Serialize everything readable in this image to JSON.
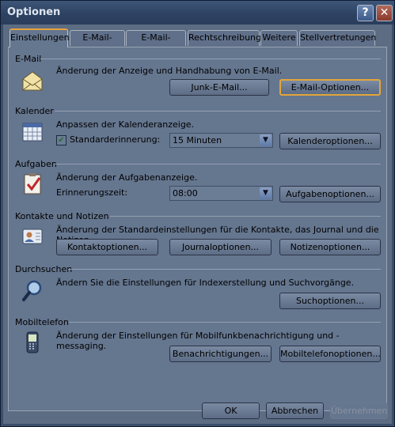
{
  "window": {
    "title": "Optionen",
    "help_glyph": "?",
    "close_glyph": "✕"
  },
  "tabs": [
    {
      "label": "Einstellungen"
    },
    {
      "label": "E-Mail-Setup"
    },
    {
      "label": "E-Mail-Format"
    },
    {
      "label": "Rechtschreibung"
    },
    {
      "label": "Weitere"
    },
    {
      "label": "Stellvertretungen"
    }
  ],
  "sections": {
    "email": {
      "heading": "E-Mail",
      "description": "Änderung der Anzeige und Handhabung von E-Mail.",
      "junk_button": "Junk-E-Mail...",
      "options_button": "E-Mail-Optionen..."
    },
    "calendar": {
      "heading": "Kalender",
      "description": "Anpassen der Kalenderanzeige.",
      "reminder_label": "Standarderinnerung:",
      "reminder_checked": true,
      "reminder_value": "15 Minuten",
      "options_button": "Kalenderoptionen..."
    },
    "tasks": {
      "heading": "Aufgaben",
      "description": "Änderung der Aufgabenanzeige.",
      "reminder_time_label": "Erinnerungszeit:",
      "reminder_time_value": "08:00",
      "options_button": "Aufgabenoptionen..."
    },
    "contacts": {
      "heading": "Kontakte und Notizen",
      "description": "Änderung der Standardeinstellungen für die Kontakte, das Journal und die Notizen.",
      "contact_button": "Kontaktoptionen...",
      "journal_button": "Journaloptionen...",
      "notes_button": "Notizenoptionen..."
    },
    "search": {
      "heading": "Durchsuchen",
      "description": "Ändern Sie die Einstellungen für Indexerstellung und Suchvorgänge.",
      "options_button": "Suchoptionen..."
    },
    "mobile": {
      "heading": "Mobiltelefon",
      "description": "Änderung der Einstellungen für Mobilfunkbenachrichtigung und -messaging.",
      "notifications_button": "Benachrichtigungen...",
      "mobile_button": "Mobiltelefonoptionen..."
    }
  },
  "footer": {
    "ok": "OK",
    "cancel": "Abbrechen",
    "apply": "Übernehmen"
  }
}
